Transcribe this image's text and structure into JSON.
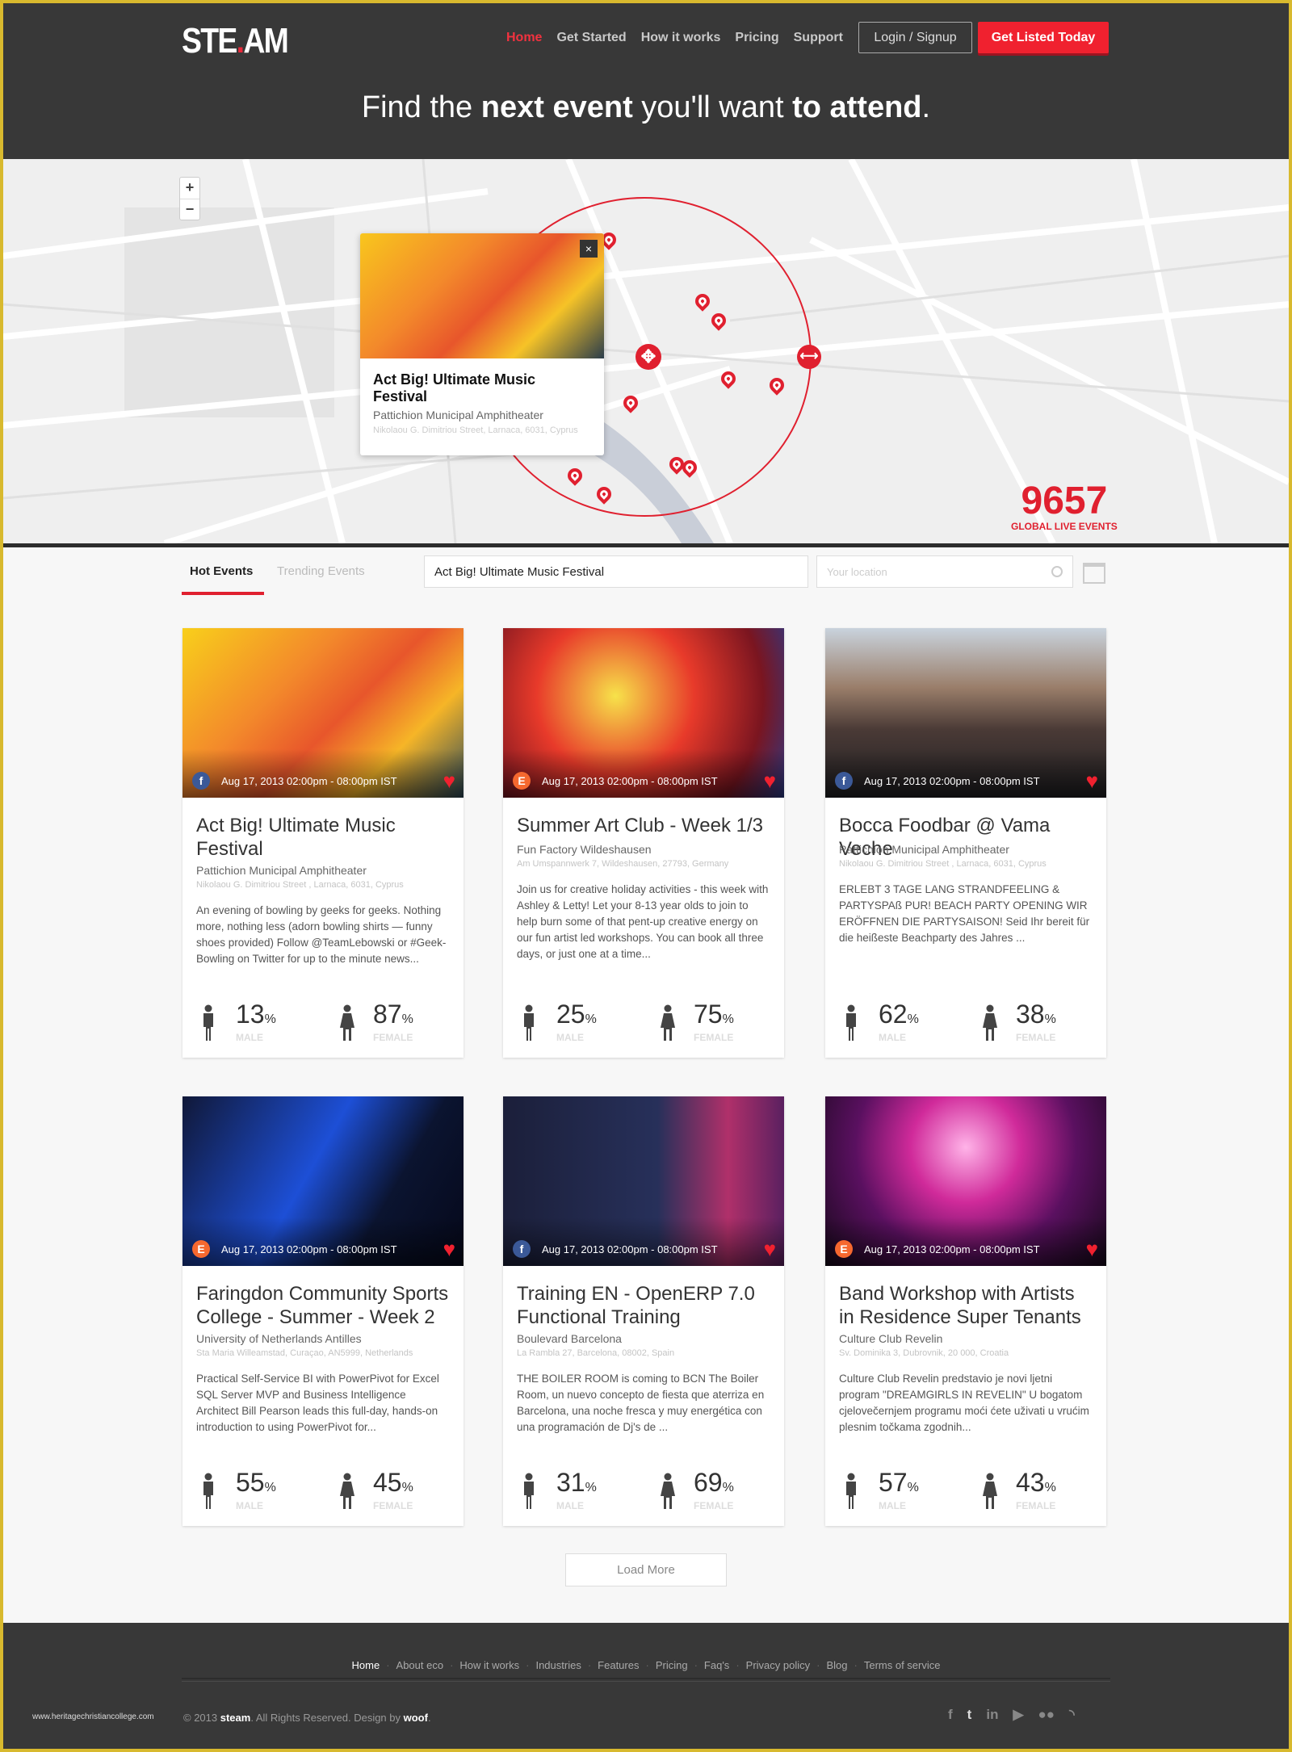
{
  "header": {
    "logo": {
      "left": "STE",
      "dot": ".",
      "right": "AM"
    },
    "nav": [
      {
        "label": "Home",
        "active": true
      },
      {
        "label": "Get Started"
      },
      {
        "label": "How it works"
      },
      {
        "label": "Pricing"
      },
      {
        "label": "Support"
      }
    ],
    "login_label": "Login / Signup",
    "cta_label": "Get Listed Today",
    "hero": {
      "p1": "Find the ",
      "b1": "next event",
      "p2": " you'll want ",
      "b2": "to attend",
      "p3": "."
    }
  },
  "map": {
    "zoom_in": "+",
    "zoom_out": "−",
    "popup": {
      "title": "Act Big! Ultimate Music Festival",
      "venue": "Pattichion Municipal Amphitheater",
      "address": "Nikolaou G. Dimitriou Street, Larnaca, 6031, Cyprus",
      "close": "×"
    },
    "counter": {
      "value": "9657",
      "label": "GLOBAL LIVE EVENTS"
    },
    "accent": "#e0202f"
  },
  "filters": {
    "tabs": [
      {
        "label": "Hot Events",
        "active": true
      },
      {
        "label": "Trending Events"
      }
    ],
    "search_value": "Act Big! Ultimate Music Festival",
    "location_placeholder": "Your location"
  },
  "labels": {
    "male": "MALE",
    "female": "FEMALE",
    "pct": "%"
  },
  "events": [
    {
      "title": "Act Big! Ultimate Music Festival",
      "venue": "Pattichion Municipal Amphitheater",
      "address": "Nikolaou G. Dimitriou Street , Larnaca, 6031, Cyprus",
      "description": "An evening of bowling by geeks for geeks. Nothing more, nothing less (adorn bowling shirts — funny shoes provided) Follow @TeamLebowski or #Geek-Bowling on Twitter for up to the minute news...",
      "date": "Aug 17, 2013 02:00pm - 08:00pm IST",
      "source": "f",
      "male": "13",
      "female": "87"
    },
    {
      "title": "Summer Art Club - Week 1/3",
      "venue": "Fun Factory Wildeshausen",
      "address": "Am Umspannwerk 7, Wildeshausen, 27793, Germany",
      "description": "Join us for creative holiday activities - this week with Ashley & Letty! Let your 8-13 year olds to join to help burn some of that pent-up creative energy on our fun artist led workshops. You can book all three days, or just one at a time...",
      "date": "Aug 17, 2013 02:00pm - 08:00pm IST",
      "source": "E",
      "male": "25",
      "female": "75"
    },
    {
      "title": "Bocca Foodbar @ Vama Veche",
      "venue": "Pattichion Municipal Amphitheater",
      "address": "Nikolaou G. Dimitriou Street , Larnaca, 6031, Cyprus",
      "description": "ERLEBT 3 TAGE LANG STRANDFEELING & PARTYSPAß PUR! BEACH PARTY OPENING WIR ERÖFFNEN DIE PARTYSAISON! Seid Ihr bereit für die heißeste Beachparty des Jahres ...",
      "date": "Aug 17, 2013 02:00pm - 08:00pm IST",
      "source": "f",
      "male": "62",
      "female": "38"
    },
    {
      "title": "Faringdon Community Sports College - Summer - Week 2",
      "venue": "University of Netherlands Antilles",
      "address": "Sta Maria Willeamstad, Curaçao, AN5999, Netherlands",
      "description": "Practical Self-Service BI with PowerPivot for Excel SQL Server MVP and Business Intelligence Architect Bill Pearson leads this full-day, hands-on introduction to using PowerPivot for...",
      "date": "Aug 17, 2013 02:00pm - 08:00pm IST",
      "source": "E",
      "male": "55",
      "female": "45"
    },
    {
      "title": "Training EN - OpenERP 7.0 Functional Training",
      "venue": "Boulevard Barcelona",
      "address": "La Rambla 27, Barcelona, 08002, Spain",
      "description": "THE BOILER ROOM is coming to BCN The Boiler Room, un nuevo concepto de fiesta que aterriza en Barcelona, una noche fresca y muy energética con una programación de Dj's de ...",
      "date": "Aug 17, 2013 02:00pm - 08:00pm IST",
      "source": "f",
      "male": "31",
      "female": "69"
    },
    {
      "title": "Band Workshop with Artists in Residence Super Tenants",
      "venue": "Culture Club Revelin",
      "address": "Sv. Dominika 3, Dubrovnik, 20 000, Croatia",
      "description": "Culture Club Revelin predstavio je novi ljetni program \"DREAMGIRLS IN REVELIN\" U bogatom cjelovečernjem programu moći ćete uživati u vrućim plesnim točkama zgodnih...",
      "date": "Aug 17, 2013 02:00pm - 08:00pm IST",
      "source": "E",
      "male": "57",
      "female": "43"
    }
  ],
  "load_more": "Load More",
  "footer": {
    "links": [
      {
        "label": "Home",
        "active": true
      },
      {
        "label": "About eco"
      },
      {
        "label": "How it works"
      },
      {
        "label": "Industries"
      },
      {
        "label": "Features"
      },
      {
        "label": "Pricing"
      },
      {
        "label": "Faq's"
      },
      {
        "label": "Privacy policy"
      },
      {
        "label": "Blog"
      },
      {
        "label": "Terms of service"
      }
    ],
    "watermark": "www.heritagechristiancollege.com",
    "copyright": {
      "prefix": "© 2013 ",
      "brand": "steam",
      "mid": ". All Rights Reserved. Design by ",
      "designer": "woof",
      "end": "."
    },
    "social": [
      "facebook-icon",
      "twitter-icon",
      "linkedin-icon",
      "play-icon",
      "flickr-icon",
      "rss-icon"
    ]
  },
  "colors": {
    "accent": "#f0212f",
    "header_bg": "#383838",
    "facebook": "#3b5998",
    "eventbrite": "#f6682f"
  }
}
